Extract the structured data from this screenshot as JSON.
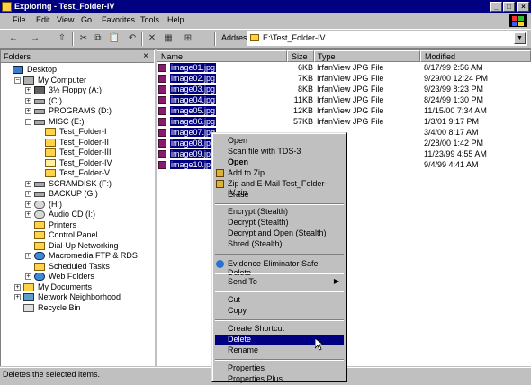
{
  "window": {
    "title": "Exploring - Test_Folder-IV",
    "buttons": {
      "minimize": "_",
      "maximize": "□",
      "close": "×"
    }
  },
  "menubar": [
    "File",
    "Edit",
    "View",
    "Go",
    "Favorites",
    "Tools",
    "Help"
  ],
  "toolbar": {
    "back": "←",
    "forward": "→",
    "up": "⇧",
    "cut": "✂",
    "copy": "⧉",
    "paste": "📋",
    "undo": "↶",
    "delete": "✕",
    "properties": "▦",
    "views": "⊞",
    "address_label": "Address",
    "address_value": "E:\\Test_Folder-IV",
    "dropdown": "▼"
  },
  "left_pane": {
    "header": "Folders",
    "close": "×",
    "tree": [
      {
        "label": "Desktop",
        "expander": ""
      },
      {
        "label": "My Computer",
        "expander": "-"
      },
      {
        "label": "3½ Floppy (A:)",
        "expander": "+"
      },
      {
        "label": "(C:)",
        "expander": "+"
      },
      {
        "label": "PROGRAMS (D:)",
        "expander": "+"
      },
      {
        "label": "MISC (E:)",
        "expander": "-"
      },
      {
        "label": "Test_Folder-I",
        "expander": ""
      },
      {
        "label": "Test_Folder-II",
        "expander": ""
      },
      {
        "label": "Test_Folder-III",
        "expander": ""
      },
      {
        "label": "Test_Folder-IV",
        "expander": ""
      },
      {
        "label": "Test_Folder-V",
        "expander": ""
      },
      {
        "label": "SCRAMDISK (F:)",
        "expander": "+"
      },
      {
        "label": "BACKUP (G:)",
        "expander": "+"
      },
      {
        "label": "(H:)",
        "expander": "+"
      },
      {
        "label": "Audio CD (I:)",
        "expander": "+"
      },
      {
        "label": "Printers",
        "expander": ""
      },
      {
        "label": "Control Panel",
        "expander": ""
      },
      {
        "label": "Dial-Up Networking",
        "expander": ""
      },
      {
        "label": "Macromedia FTP & RDS",
        "expander": "+"
      },
      {
        "label": "Scheduled Tasks",
        "expander": ""
      },
      {
        "label": "Web Folders",
        "expander": "+"
      },
      {
        "label": "My Documents",
        "expander": "+"
      },
      {
        "label": "Network Neighborhood",
        "expander": "+"
      },
      {
        "label": "Recycle Bin",
        "expander": ""
      }
    ]
  },
  "file_list": {
    "columns": [
      "Name",
      "Size",
      "Type",
      "Modified"
    ],
    "rows": [
      {
        "name": "image01.jpg",
        "size": "6KB",
        "type": "IrfanView JPG File",
        "modified": "8/17/99 2:56 AM"
      },
      {
        "name": "image02.jpg",
        "size": "7KB",
        "type": "IrfanView JPG File",
        "modified": "9/29/00 12:24 PM"
      },
      {
        "name": "image03.jpg",
        "size": "8KB",
        "type": "IrfanView JPG File",
        "modified": "9/23/99 8:23 PM"
      },
      {
        "name": "image04.jpg",
        "size": "11KB",
        "type": "IrfanView JPG File",
        "modified": "8/24/99 1:30 PM"
      },
      {
        "name": "image05.jpg",
        "size": "12KB",
        "type": "IrfanView JPG File",
        "modified": "11/15/00 7:34 AM"
      },
      {
        "name": "image06.jpg",
        "size": "57KB",
        "type": "IrfanView JPG File",
        "modified": "1/3/01 9:17 PM"
      },
      {
        "name": "image07.jpg",
        "size": "",
        "type": "",
        "modified": "3/4/00 8:17 AM"
      },
      {
        "name": "image08.jpg",
        "size": "",
        "type": "",
        "modified": "2/28/00 1:42 PM"
      },
      {
        "name": "image09.jpg",
        "size": "",
        "type": "",
        "modified": "11/23/99 4:55 AM"
      },
      {
        "name": "image10.jpg",
        "size": "",
        "type": "",
        "modified": "9/4/99 4:41 AM"
      }
    ]
  },
  "context_menu": {
    "open": "Open",
    "scan": "Scan file with TDS-3",
    "open_bold": "Open",
    "add_zip": "Add to Zip",
    "zip_email": "Zip and E-Mail Test_Folder-IV.zip",
    "erase": "Erase",
    "encrypt": "Encrypt (Stealth)",
    "decrypt": "Decrypt (Stealth)",
    "decrypt_open": "Decrypt and Open (Stealth)",
    "shred": "Shred (Stealth)",
    "evidence": "Evidence Eliminator Safe Delete",
    "send_to": "Send To",
    "cut": "Cut",
    "copy": "Copy",
    "create_shortcut": "Create Shortcut",
    "delete": "Delete",
    "rename": "Rename",
    "properties": "Properties",
    "properties_plus": "Properties Plus",
    "submenu_arrow": "▶"
  },
  "status": "Deletes the selected items.",
  "colors": {
    "titlebar": "#000080",
    "selection": "#000080",
    "face": "#c0c0c0"
  }
}
